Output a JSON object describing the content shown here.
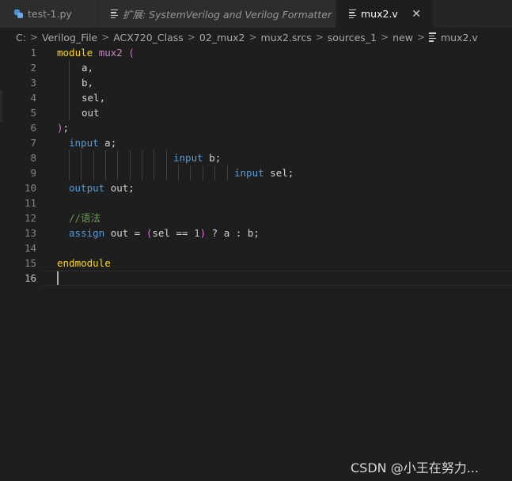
{
  "tabs": [
    {
      "label": "test-1.py",
      "icon": "python-file-icon",
      "active": false
    },
    {
      "label": "扩展: SystemVerilog and Verilog Formatter",
      "icon": "extension-preview-icon",
      "active": false
    },
    {
      "label": "mux2.v",
      "icon": "text-file-icon",
      "active": true,
      "close": "✕"
    }
  ],
  "breadcrumb": [
    "C:",
    "Verilog_File",
    "ACX720_Class",
    "02_mux2",
    "mux2.srcs",
    "sources_1",
    "new",
    "mux2.v"
  ],
  "breadcrumb_separator": ">",
  "editor": {
    "line_numbers": [
      "1",
      "2",
      "3",
      "4",
      "5",
      "6",
      "7",
      "8",
      "9",
      "10",
      "11",
      "12",
      "13",
      "14",
      "15",
      "16"
    ],
    "current_line": "16",
    "code": {
      "module_kw": "module",
      "module_name": "mux2",
      "open_paren": "(",
      "port_a": "a,",
      "port_b": "b,",
      "port_sel": "sel,",
      "port_out": "out",
      "close_paren": ")",
      "semicolon": ";",
      "input_kw": "input",
      "decl_a": "a;",
      "decl_b": "b;",
      "decl_sel": "sel;",
      "output_kw": "output",
      "decl_out": "out;",
      "comment": "//语法",
      "assign_kw": "assign",
      "assign_lhs": "out = ",
      "assign_cond": "sel == ",
      "assign_one": "1",
      "assign_rest": " ? a : b;",
      "endmodule_kw": "endmodule"
    }
  },
  "watermark": "CSDN @小王在努力...",
  "colors": {
    "background": "#1e1e1e",
    "tab_bar": "#252526",
    "keyword_module": "#ffd700",
    "keyword_decl": "#569cd6",
    "bracket": "#da70d6",
    "number": "#b5cea8",
    "comment": "#6a9955"
  }
}
